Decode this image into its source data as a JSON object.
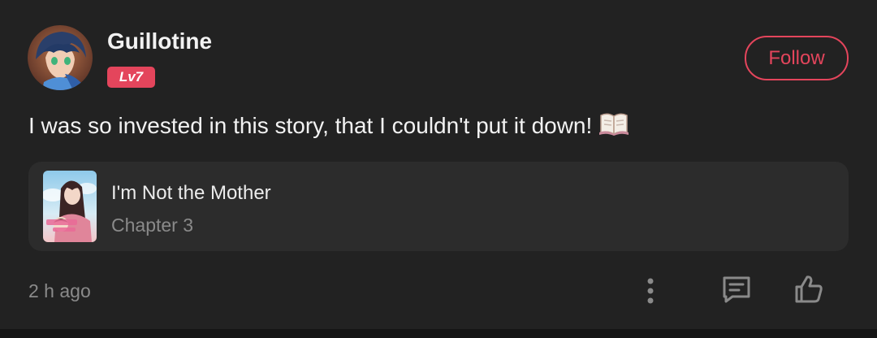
{
  "post": {
    "username": "Guillotine",
    "level_badge": "Lv7",
    "follow_label": "Follow",
    "comment": "I was so invested in this story, that I couldn't put it down!",
    "timestamp": "2 h ago"
  },
  "story": {
    "title": "I'm Not the Mother",
    "chapter": "Chapter 3"
  },
  "actions": {
    "more_icon": "more-vertical-icon",
    "comment_icon": "comment-icon",
    "like_icon": "thumbs-up-icon"
  },
  "colors": {
    "background": "#222222",
    "accent": "#e4455c",
    "card": "#2c2c2c",
    "text_primary": "#f2f2f2",
    "text_secondary": "#8a8a8a"
  }
}
